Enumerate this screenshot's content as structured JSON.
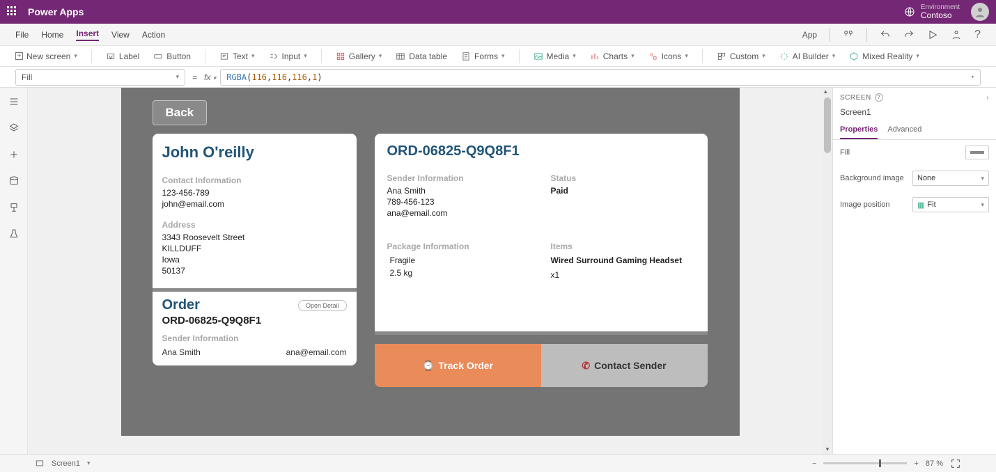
{
  "header": {
    "app_name": "Power Apps",
    "env_label": "Environment",
    "env_name": "Contoso"
  },
  "menu": {
    "items": [
      "File",
      "Home",
      "Insert",
      "View",
      "Action"
    ],
    "active_index": 2,
    "app_label": "App"
  },
  "ribbon": {
    "new_screen": "New screen",
    "label": "Label",
    "button": "Button",
    "text": "Text",
    "input": "Input",
    "gallery": "Gallery",
    "datatable": "Data table",
    "forms": "Forms",
    "media": "Media",
    "charts": "Charts",
    "icons": "Icons",
    "custom": "Custom",
    "aibuilder": "AI Builder",
    "mixed": "Mixed Reality"
  },
  "fx": {
    "property": "Fill",
    "fn": "RGBA",
    "args": "(116, 116, 116, 1)"
  },
  "props": {
    "pane_title": "SCREEN",
    "object": "Screen1",
    "tabs": [
      "Properties",
      "Advanced"
    ],
    "fill_label": "Fill",
    "bgimg_label": "Background image",
    "bgimg_value": "None",
    "imgpos_label": "Image position",
    "imgpos_value": "Fit"
  },
  "bottom": {
    "screen": "Screen1",
    "zoom": "87  %"
  },
  "canvas": {
    "back": "Back",
    "contact": {
      "name": "John O'reilly",
      "hdr_contact": "Contact Information",
      "phone": "123-456-789",
      "email": "john@email.com",
      "hdr_addr": "Address",
      "addr1": "3343  Roosevelt Street",
      "addr2": "KILLDUFF",
      "addr3": "Iowa",
      "addr4": "50137"
    },
    "orderCard": {
      "title": "Order",
      "open": "Open Detail",
      "number": "ORD-06825-Q9Q8F1",
      "hdr_sender": "Sender Information",
      "sender_name": "Ana Smith",
      "sender_email": "ana@email.com"
    },
    "orderDetail": {
      "number": "ORD-06825-Q9Q8F1",
      "hdr_sender": "Sender Information",
      "sender_name": "Ana Smith",
      "sender_phone": "789-456-123",
      "sender_email": "ana@email.com",
      "hdr_status": "Status",
      "status": "Paid",
      "hdr_pkg": "Package Information",
      "pkg1": "Fragile",
      "pkg2": "2.5 kg",
      "hdr_items": "Items",
      "item_name": "Wired Surround Gaming Headset",
      "item_qty": "x1",
      "track": "Track Order",
      "contact": "Contact Sender"
    }
  }
}
